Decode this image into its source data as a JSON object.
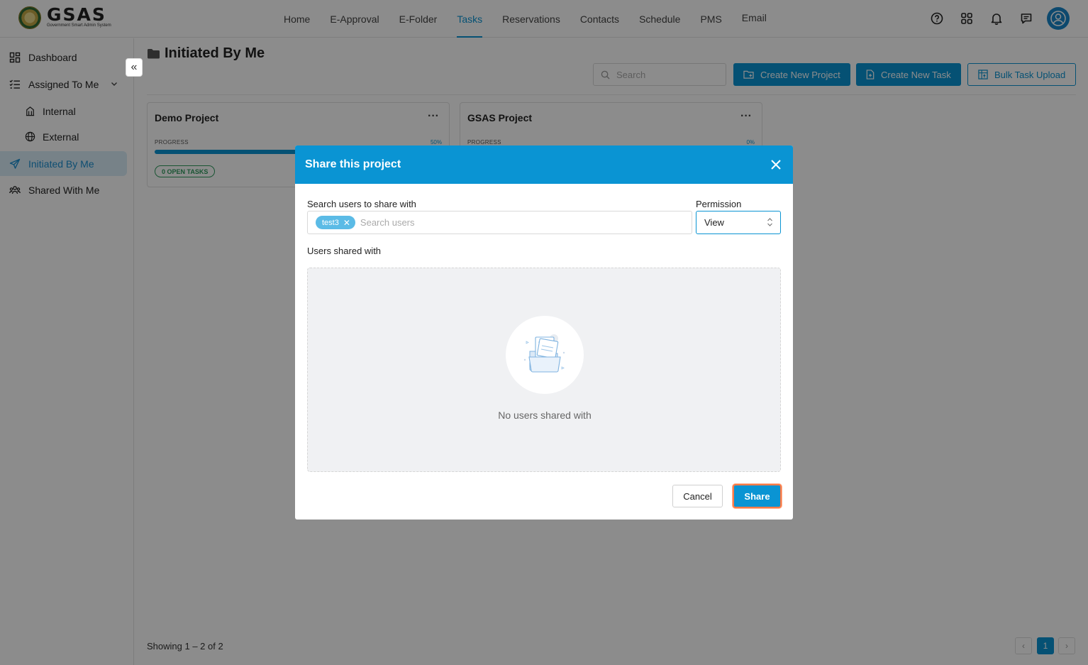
{
  "app": {
    "logo_text": "GSAS",
    "logo_subtext": "Government Smart Admin System"
  },
  "nav": {
    "items": [
      {
        "label": "Home"
      },
      {
        "label": "E-Approval"
      },
      {
        "label": "E-Folder"
      },
      {
        "label": "Tasks"
      },
      {
        "label": "Reservations"
      },
      {
        "label": "Contacts"
      },
      {
        "label": "Schedule"
      },
      {
        "label": "PMS"
      },
      {
        "label": "Email"
      }
    ],
    "active": "Tasks",
    "icons": [
      "help-icon",
      "apps-grid-icon",
      "bell-icon",
      "chat-icon",
      "user-avatar-icon"
    ]
  },
  "sidebar": {
    "items": [
      {
        "label": "Dashboard",
        "icon": "dashboard-icon"
      },
      {
        "label": "Assigned To Me",
        "icon": "list-check-icon"
      },
      {
        "label": "Internal",
        "icon": "building-icon"
      },
      {
        "label": "External",
        "icon": "globe-icon"
      },
      {
        "label": "Initiated By Me",
        "icon": "send-icon"
      },
      {
        "label": "Shared With Me",
        "icon": "users-icon"
      }
    ],
    "active": "Initiated By Me"
  },
  "main": {
    "title": "Initiated By Me",
    "search_placeholder": "Search",
    "buttons": {
      "create_project": "Create New Project",
      "create_task": "Create New Task",
      "bulk_upload": "Bulk Task Upload"
    },
    "projects": [
      {
        "name": "Demo Project",
        "progress_label": "PROGRESS",
        "progress_text": "50%",
        "progress_fraction": 0.5,
        "badge": "0 OPEN TASKS"
      },
      {
        "name": "GSAS Project",
        "progress_label": "PROGRESS",
        "progress_text": "0%",
        "progress_fraction": 0.0,
        "badge": ""
      }
    ],
    "footer": "Showing 1 – 2 of 2",
    "pagination": {
      "prev": "‹",
      "current": "1",
      "next": "›"
    }
  },
  "modal": {
    "title": "Share this project",
    "search_label": "Search users to share with",
    "selected_users": [
      "test3"
    ],
    "search_placeholder": "Search users",
    "permission_label": "Permission",
    "permission_value": "View",
    "shared_label": "Users shared with",
    "empty_text": "No users shared with",
    "cancel_label": "Cancel",
    "share_label": "Share"
  },
  "colors": {
    "accent": "#0a94d3",
    "success": "#2e9b5e",
    "focus_ring": "#ff7a45"
  }
}
